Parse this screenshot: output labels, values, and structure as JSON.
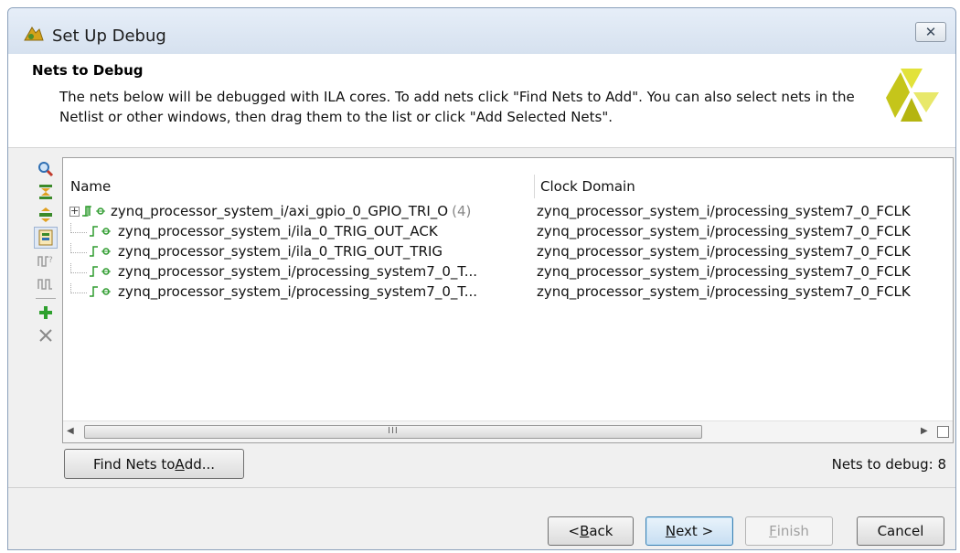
{
  "window": {
    "title": "Set Up Debug",
    "close_glyph": "✕"
  },
  "header": {
    "title": "Nets to Debug",
    "description": "The nets below will be debugged with ILA cores. To add nets click \"Find Nets to Add\". You can also select nets in the Netlist or other windows, then drag them to the list or click \"Add Selected Nets\"."
  },
  "toolbar": {
    "icons": [
      "search-icon",
      "collapse-all-icon",
      "expand-all-icon",
      "group-by-clock-icon",
      "probe-type-icon",
      "waveform-icon",
      "add-icon",
      "remove-icon"
    ]
  },
  "table": {
    "columns": [
      "Name",
      "Clock Domain"
    ],
    "rows": [
      {
        "name": "zynq_processor_system_i/axi_gpio_0_GPIO_TRI_O",
        "count": "(4)",
        "clock": "zynq_processor_system_i/processing_system7_0_FCLK",
        "expandable": true
      },
      {
        "name": "zynq_processor_system_i/ila_0_TRIG_OUT_ACK",
        "count": "",
        "clock": "zynq_processor_system_i/processing_system7_0_FCLK",
        "expandable": false
      },
      {
        "name": "zynq_processor_system_i/ila_0_TRIG_OUT_TRIG",
        "count": "",
        "clock": "zynq_processor_system_i/processing_system7_0_FCLK",
        "expandable": false
      },
      {
        "name": "zynq_processor_system_i/processing_system7_0_T...",
        "count": "",
        "clock": "zynq_processor_system_i/processing_system7_0_FCLK",
        "expandable": false
      },
      {
        "name": "zynq_processor_system_i/processing_system7_0_T...",
        "count": "",
        "clock": "zynq_processor_system_i/processing_system7_0_FCLK",
        "expandable": false
      }
    ],
    "scroll_grip": "III"
  },
  "find_button": {
    "pre": "Find Nets to ",
    "mnemonic": "A",
    "post": "dd..."
  },
  "nets_count_label": "Nets to debug: 8",
  "buttons": {
    "back": {
      "pre": "< ",
      "mnemonic": "B",
      "post": "ack"
    },
    "next": {
      "pre": "",
      "mnemonic": "N",
      "post": "ext >"
    },
    "finish": {
      "pre": "",
      "mnemonic": "F",
      "post": "inish"
    },
    "cancel": "Cancel"
  },
  "colors": {
    "accent": "#3c7fb1",
    "net_green": "#2e9b2e",
    "logo_yellow": "#c8c800"
  }
}
